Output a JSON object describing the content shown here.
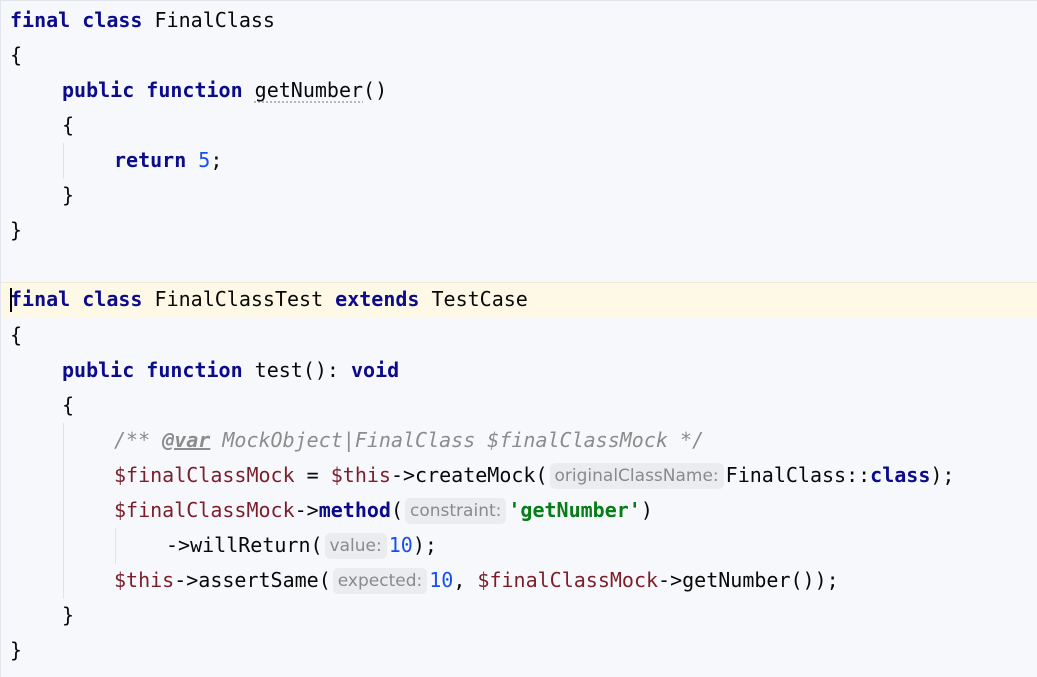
{
  "code": {
    "class1": {
      "kw_final": "final",
      "kw_class": "class",
      "name": "FinalClass",
      "open_brace": "{",
      "method_kw_public": "public",
      "method_kw_function": "function",
      "method_name": "getNumber",
      "method_parens": "()",
      "method_open": "{",
      "return_kw": "return",
      "return_value": "5",
      "semicolon": ";",
      "method_close": "}",
      "close_brace": "}"
    },
    "class2": {
      "kw_final": "final",
      "kw_class": "class",
      "name": "FinalClassTest",
      "kw_extends": "extends",
      "parent": "TestCase",
      "open_brace": "{",
      "method_kw_public": "public",
      "method_kw_function": "function",
      "method_sig": "test(): ",
      "return_type": "void",
      "method_open": "{",
      "doc_open": "/** ",
      "doc_tag": "@var",
      "doc_rest": " MockObject|FinalClass $finalClassMock */",
      "line1_var": "$finalClassMock",
      "line1_eq": " = ",
      "line1_this": "$this",
      "line1_call": "->createMock(",
      "line1_hint": "originalClassName:",
      "line1_arg": "FinalClass::",
      "line1_kw_class": "class",
      "line1_end": ");",
      "line2_var": "$finalClassMock",
      "line2_arrow": "->",
      "line2_method": "method",
      "line2_paren": "(",
      "line2_hint": "constraint:",
      "line2_str": "'getNumber'",
      "line2_end": ")",
      "line3_call": "->willReturn(",
      "line3_hint": "value:",
      "line3_num": "10",
      "line3_end": ");",
      "line4_this": "$this",
      "line4_call": "->assertSame(",
      "line4_hint": "expected:",
      "line4_num": "10",
      "line4_comma": ", ",
      "line4_var": "$finalClassMock",
      "line4_end": "->getNumber());",
      "method_close": "}",
      "close_brace": "}"
    }
  }
}
